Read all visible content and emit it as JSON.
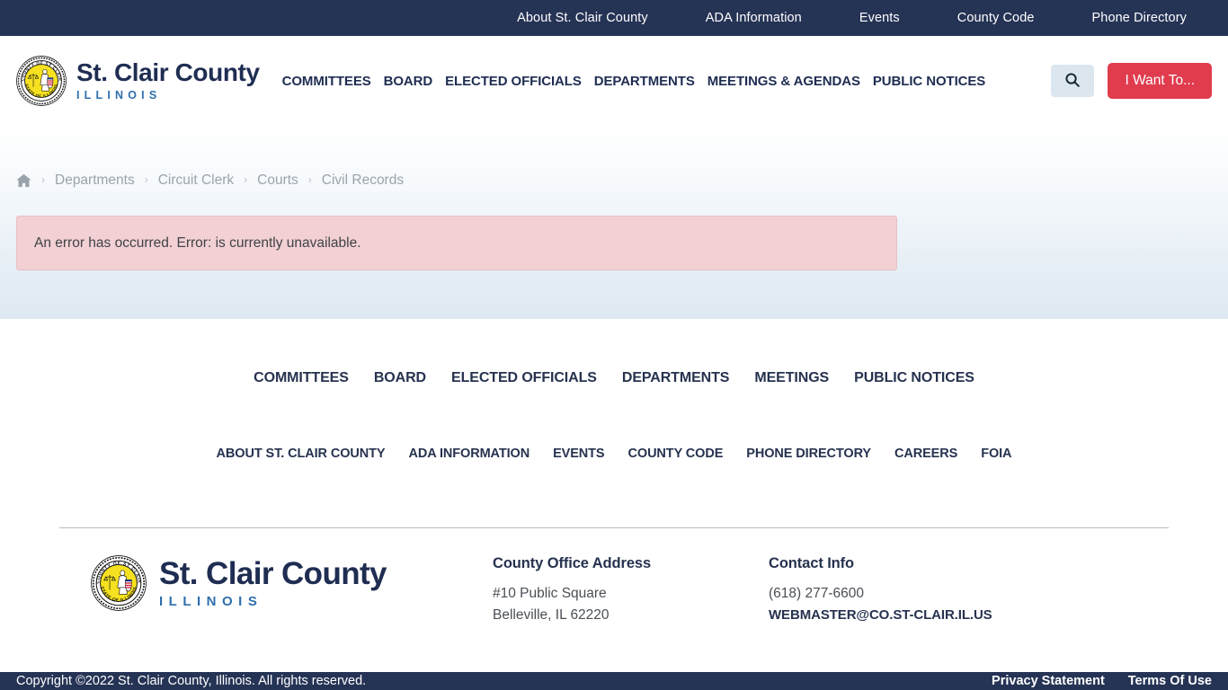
{
  "topbar": {
    "links": [
      "About St. Clair County",
      "ADA Information",
      "Events",
      "County Code",
      "Phone Directory"
    ]
  },
  "brand": {
    "name": "St. Clair County",
    "subtitle": "ILLINOIS",
    "seal_label": "St. Clair County Illinois seal",
    "seal_ring_top": "COUNTY OF ST CLAIR",
    "seal_ring_bottom": "STATE OF ILLINOIS"
  },
  "mainnav": {
    "links": [
      "COMMITTEES",
      "BOARD",
      "ELECTED OFFICIALS",
      "DEPARTMENTS",
      "MEETINGS & AGENDAS",
      "PUBLIC NOTICES"
    ],
    "search_label": "Search",
    "i_want_to_label": "I Want To..."
  },
  "breadcrumb": {
    "home_label": "Home",
    "separator": "›",
    "items": [
      "Departments",
      "Circuit Clerk",
      "Courts",
      "Civil Records"
    ]
  },
  "alert": {
    "message": "An error has occurred. Error: is currently unavailable."
  },
  "footer_nav": {
    "primary": [
      "COMMITTEES",
      "BOARD",
      "ELECTED OFFICIALS",
      "DEPARTMENTS",
      "MEETINGS",
      "PUBLIC NOTICES"
    ],
    "secondary": [
      "ABOUT ST. CLAIR COUNTY",
      "ADA INFORMATION",
      "EVENTS",
      "COUNTY CODE",
      "PHONE DIRECTORY",
      "CAREERS",
      "FOIA"
    ]
  },
  "footer_info": {
    "address_heading": "County Office Address",
    "address_line1": "#10 Public Square",
    "address_line2": "Belleville, IL 62220",
    "contact_heading": "Contact Info",
    "phone": "(618) 277-6600",
    "email": "WEBMASTER@CO.ST-CLAIR.IL.US"
  },
  "bottombar": {
    "copyright": "Copyright ©2022 St. Clair County, Illinois. All rights reserved.",
    "links": [
      "Privacy Statement",
      "Terms Of Use"
    ]
  },
  "colors": {
    "navy": "#253355",
    "brand_navy": "#1f2d52",
    "accent_blue": "#2f6fad",
    "red": "#e03c4e",
    "search_bg": "#dce6ef",
    "alert_bg": "#f2d0d4",
    "alert_border": "#e8c0c6",
    "muted": "#9aa3ab"
  }
}
